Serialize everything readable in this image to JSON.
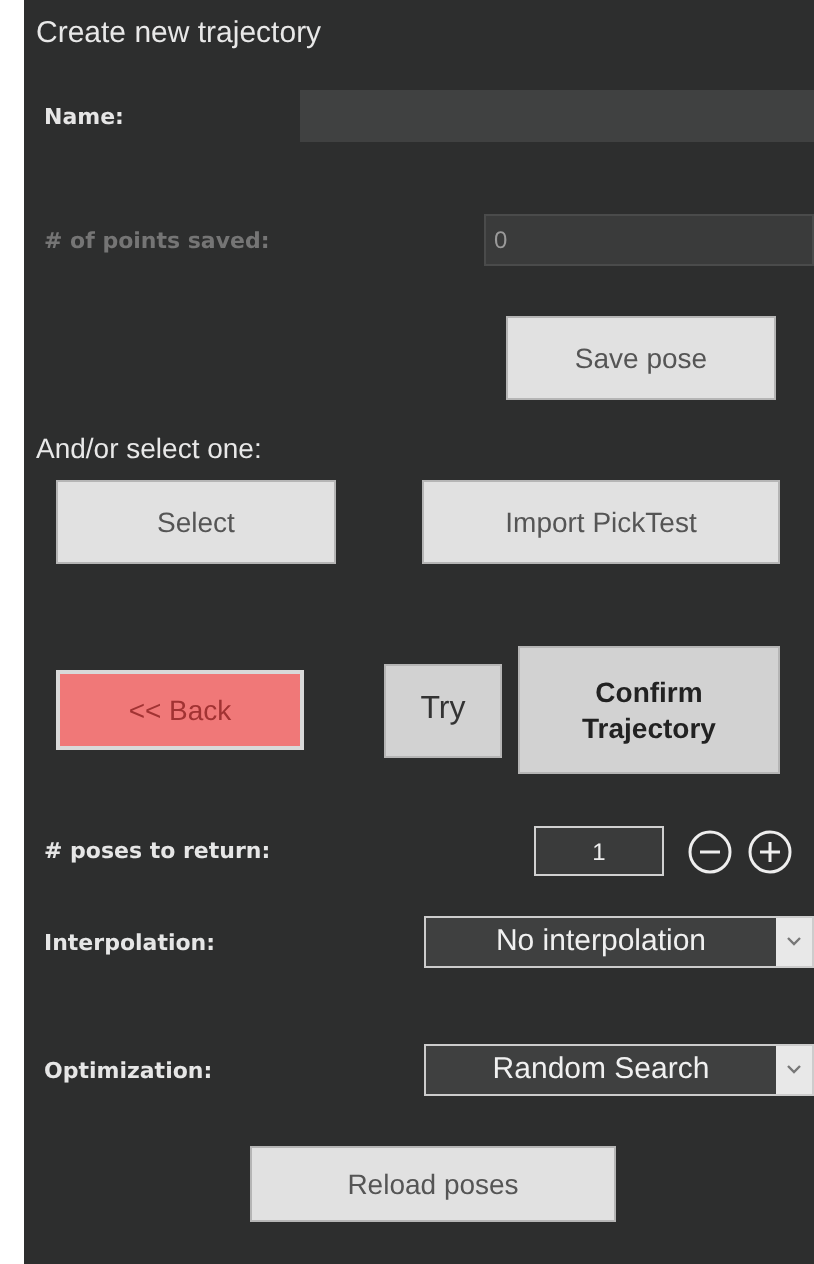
{
  "title": "Create new trajectory",
  "name_field": {
    "label": "Name:"
  },
  "points_field": {
    "label": "# of points saved:",
    "value": "0",
    "disabled": true
  },
  "save_button": "Save pose",
  "select_heading": "And/or select one:",
  "select_buttons": [
    "Select",
    "Import PickTest"
  ],
  "actions": [
    {
      "kind": "danger",
      "label": "<< Back"
    },
    {
      "kind": "small",
      "label": "Try"
    },
    {
      "kind": "primary",
      "label": "Confirm Trajectory"
    }
  ],
  "poses_to_return": {
    "label": "# poses to return:",
    "value": "1"
  },
  "dropdowns": [
    {
      "label": "Interpolation:",
      "value": "No interpolation"
    },
    {
      "label": "Optimization:",
      "value": "Random Search"
    }
  ],
  "reload_button": "Reload poses"
}
